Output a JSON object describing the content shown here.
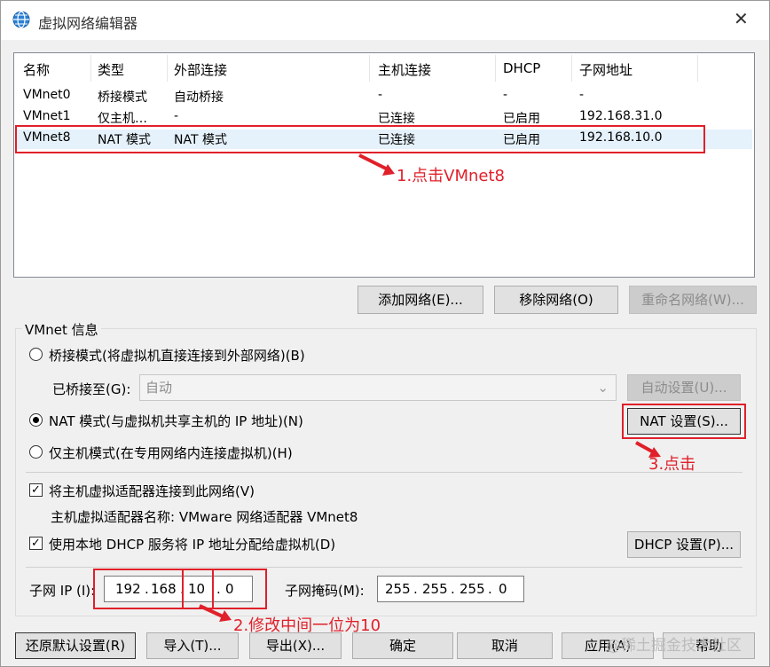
{
  "window": {
    "title": "虚拟网络编辑器",
    "close": "✕"
  },
  "table": {
    "columns": [
      "名称",
      "类型",
      "外部连接",
      "主机连接",
      "DHCP",
      "子网地址"
    ],
    "rows": [
      [
        "VMnet0",
        "桥接模式",
        "自动桥接",
        "-",
        "-",
        "-"
      ],
      [
        "VMnet1",
        "仅主机…",
        "-",
        "已连接",
        "已启用",
        "192.168.31.0"
      ],
      [
        "VMnet8",
        "NAT 模式",
        "NAT 模式",
        "已连接",
        "已启用",
        "192.168.10.0"
      ]
    ]
  },
  "buttons": {
    "add_network": "添加网络(E)...",
    "remove_network": "移除网络(O)",
    "rename_network": "重命名网络(W)...",
    "auto_settings": "自动设置(U)...",
    "nat_settings": "NAT 设置(S)...",
    "dhcp_settings": "DHCP 设置(P)...",
    "restore_defaults": "还原默认设置(R)",
    "import": "导入(T)...",
    "export": "导出(X)...",
    "ok": "确定",
    "cancel": "取消",
    "apply": "应用(A)",
    "help": "帮助"
  },
  "vmnet_info": {
    "group_label": "VMnet 信息",
    "bridged_label": "桥接模式(将虚拟机直接连接到外部网络)(B)",
    "bridged_to_label": "已桥接至(G):",
    "bridged_to_value": "自动",
    "nat_label": "NAT 模式(与虚拟机共享主机的 IP 地址)(N)",
    "host_only_label": "仅主机模式(在专用网络内连接虚拟机)(H)",
    "connect_adapter_label": "将主机虚拟适配器连接到此网络(V)",
    "adapter_name_text": "主机虚拟适配器名称: VMware 网络适配器 VMnet8",
    "use_dhcp_label": "使用本地 DHCP 服务将 IP 地址分配给虚拟机(D)",
    "subnet_ip_label": "子网 IP (I):",
    "subnet_ip": [
      "192",
      "168",
      "10",
      "0"
    ],
    "subnet_mask_label": "子网掩码(M):",
    "subnet_mask": [
      "255",
      "255",
      "255",
      "0"
    ],
    "selected_mode": "nat"
  },
  "annotations": {
    "step1": "1.点击VMnet8",
    "step2": "2.修改中间一位为10",
    "step3": "3.点击",
    "color": "#e0202a"
  },
  "watermark": "@稀土掘金技术社区"
}
